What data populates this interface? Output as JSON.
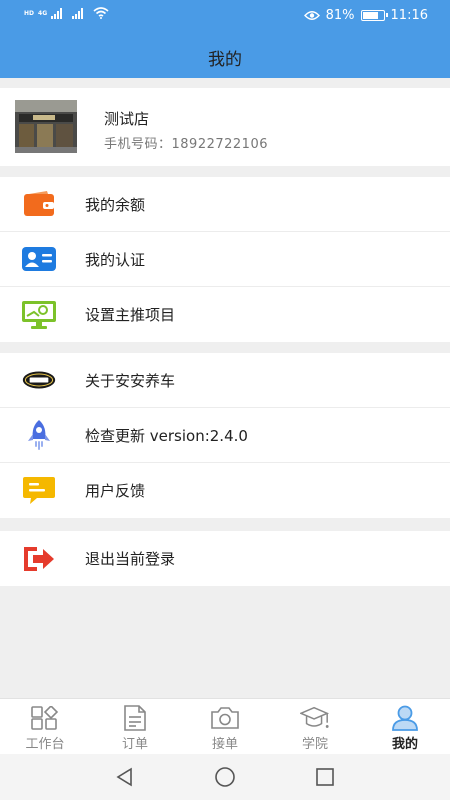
{
  "status_bar": {
    "network_left": "HD",
    "network_gen": "4G",
    "battery_percent": "81%",
    "battery_level": 0.81,
    "time": "11:16"
  },
  "header": {
    "title": "我的"
  },
  "profile": {
    "shop_name": "测试店",
    "phone_line": "手机号码：18922722106"
  },
  "menu_group_1": [
    {
      "label": "我的余额",
      "icon": "wallet-icon"
    },
    {
      "label": "我的认证",
      "icon": "id-card-icon"
    },
    {
      "label": "设置主推项目",
      "icon": "monitor-icon"
    }
  ],
  "menu_group_2": [
    {
      "label": "关于安安养车",
      "icon": "brand-logo-icon"
    },
    {
      "label": "检查更新  version:2.4.0",
      "icon": "rocket-icon"
    },
    {
      "label": "用户反馈",
      "icon": "feedback-icon"
    }
  ],
  "menu_group_3": [
    {
      "label": "退出当前登录",
      "icon": "logout-icon"
    }
  ],
  "tabbar": [
    {
      "label": "工作台",
      "icon": "workbench-icon",
      "active": false
    },
    {
      "label": "订单",
      "icon": "order-icon",
      "active": false
    },
    {
      "label": "接单",
      "icon": "camera-icon",
      "active": false
    },
    {
      "label": "学院",
      "icon": "academy-icon",
      "active": false
    },
    {
      "label": "我的",
      "icon": "user-icon",
      "active": true
    }
  ],
  "colors": {
    "header_bg": "#4a9be6",
    "wallet": "#f26b1d",
    "id_card": "#1e7be0",
    "monitor": "#7cc22a",
    "rocket": "#4a6ee0",
    "feedback": "#f5b800",
    "logout": "#e53b2c",
    "tab_active": "#4a9be6"
  }
}
